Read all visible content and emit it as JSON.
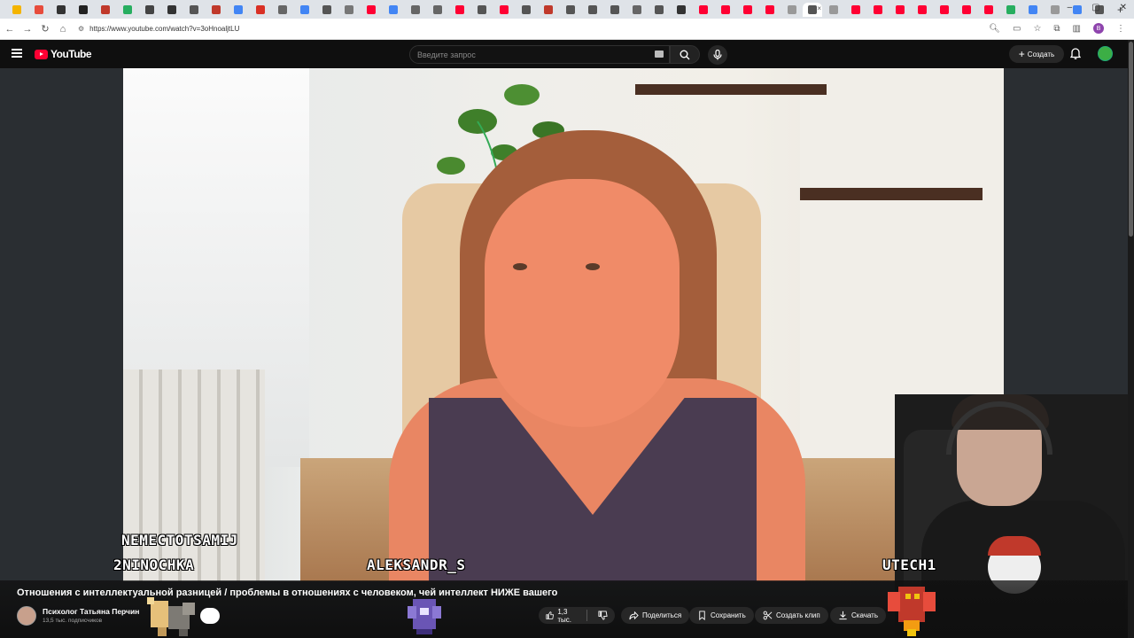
{
  "browser": {
    "url": "https://www.youtube.com/watch?v=3oHnoaljtLU",
    "tab_colors": [
      "#f4b400",
      "#e74c3c",
      "#333",
      "#222",
      "#c0392b",
      "#27ae60",
      "#444",
      "#333",
      "#555",
      "#c0392b",
      "#4285f4",
      "#d93025",
      "#666",
      "#4285f4",
      "#555",
      "#777",
      "#ff0033",
      "#4285f4",
      "#666",
      "#666",
      "#ff0033",
      "#555",
      "#ff0033",
      "#555",
      "#c0392b",
      "#555",
      "#555",
      "#555",
      "#666",
      "#555",
      "#333",
      "#ff0033",
      "#ff0033",
      "#ff0033",
      "#ff0033",
      "#999",
      "#555",
      "#999",
      "#ff0033",
      "#ff0033",
      "#ff0033",
      "#ff0033",
      "#ff0033",
      "#ff0033",
      "#ff0033",
      "#27ae60",
      "#4285f4",
      "#999",
      "#4285f4",
      "#555"
    ],
    "profile_initial": "B"
  },
  "youtube": {
    "logo_text": "YouTube",
    "search_placeholder": "Введите запрос",
    "create_label": "Создать"
  },
  "overlay_names": {
    "name1": "NEMECTOTSAMIJ",
    "name2": "2NINOCHKA",
    "name3": "ALEKSANDR_S",
    "name4": "UTECH1"
  },
  "video": {
    "title": "Отношения с интеллектуальной разницей / проблемы в отношениях с человеком, чей интеллект НИЖЕ вашего",
    "channel_name": "Психолог Татьяна Перчин",
    "subscribers": "13,5 тыс. подписчиков",
    "likes": "1,3 тыс.",
    "share_label": "Поделиться",
    "save_label": "Сохранить",
    "clip_label": "Создать клип",
    "download_label": "Скачать"
  },
  "colors": {
    "accent": "#ff0033",
    "bg": "#0f0f0f",
    "chip": "#272727"
  }
}
